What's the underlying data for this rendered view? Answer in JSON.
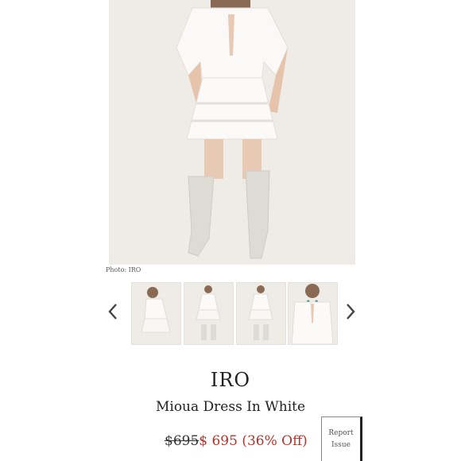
{
  "main_image": {
    "alt": "Model wearing white lace mini dress with white knee-high boots",
    "credit": "Photo: IRO"
  },
  "gallery": {
    "prev_icon": "chevron-left-icon",
    "next_icon": "chevron-right-icon",
    "thumbnails": [
      {
        "view": "side"
      },
      {
        "view": "back"
      },
      {
        "view": "front"
      },
      {
        "view": "detail"
      }
    ]
  },
  "product": {
    "brand": "IRO",
    "name": "Mioua Dress In White",
    "original_price": "$695",
    "sale_price": "$ 695 (36% Off)"
  },
  "report": {
    "line1": "Report",
    "line2": "Issue"
  },
  "colors": {
    "sale_price": "#b5342b",
    "text": "#222222"
  }
}
